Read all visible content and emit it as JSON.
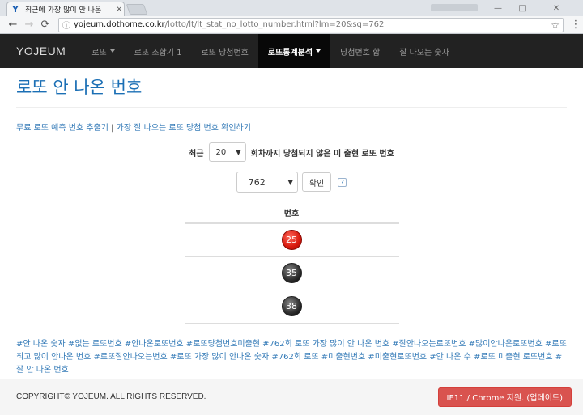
{
  "browser": {
    "tab_title": "최근에 가장 많이 안 나온",
    "tab_close": "×",
    "favicon": "Y",
    "url_domain": "yojeum.dothome.co.kr",
    "url_path": "/lotto/lt/lt_stat_no_lotto_number.html?lm=20&sq=762",
    "back": "←",
    "forward": "→",
    "reload": "C",
    "star": "☆",
    "menu": "⋮",
    "win_min": "—",
    "win_max": "□",
    "win_close": "✕"
  },
  "navbar": {
    "brand": "YOJEUM",
    "items": [
      {
        "label": "로또",
        "dropdown": true
      },
      {
        "label": "로또 조합기 1",
        "dropdown": false
      },
      {
        "label": "로또 당첨번호",
        "dropdown": false
      },
      {
        "label": "로또통계분석",
        "dropdown": true,
        "active": true
      },
      {
        "label": "당첨번호 합",
        "dropdown": false
      },
      {
        "label": "잘 나오는 숫자",
        "dropdown": false
      }
    ]
  },
  "page": {
    "title": "로또 안 나온 번호",
    "link1": "무료 로또 예측 번호 추출기",
    "link_sep": " | ",
    "link2": "가장 잘 나오는 로또 당첨 번호 확인하기",
    "filter_prefix": "최근",
    "filter_value": "20",
    "filter_suffix": "회차까지 당첨되지 않은 미 출현 로또 번호",
    "round_value": "762",
    "confirm_label": "확인",
    "help_label": "?",
    "table_header": "번호",
    "numbers": [
      {
        "value": "25",
        "color": "red"
      },
      {
        "value": "35",
        "color": "black"
      },
      {
        "value": "38",
        "color": "black"
      }
    ],
    "tags": "#안 나온 숫자 #없는 로또번호 #안나온로또번호 #로또당첨번호미출현 #762회 로또 가장 많이 안 나온 번호 #잘안나오는로또번호 #많이안나온로또번호 #로또 최고 많이 안나온 번호 #로또잘안나오는번호 #로또 가장 많이 안나온 숫자 #762회 로또 #미출현번호 #미출현로또번호 #안 나온 수 #로또 미출현 로또번호 #잘 안 나온 번호"
  },
  "footer": {
    "copyright": "COPYRIGHT© YOJEUM. ALL RIGHTS RESERVED.",
    "update_button": "IE11 / Chrome 지원. (업데이드)"
  },
  "colors": {
    "navbar_bg": "#222222",
    "title_blue": "#1b6fb5",
    "link_blue": "#337ab7",
    "danger": "#d9534f",
    "ball_red": "#d8190d",
    "ball_black": "#333333"
  }
}
